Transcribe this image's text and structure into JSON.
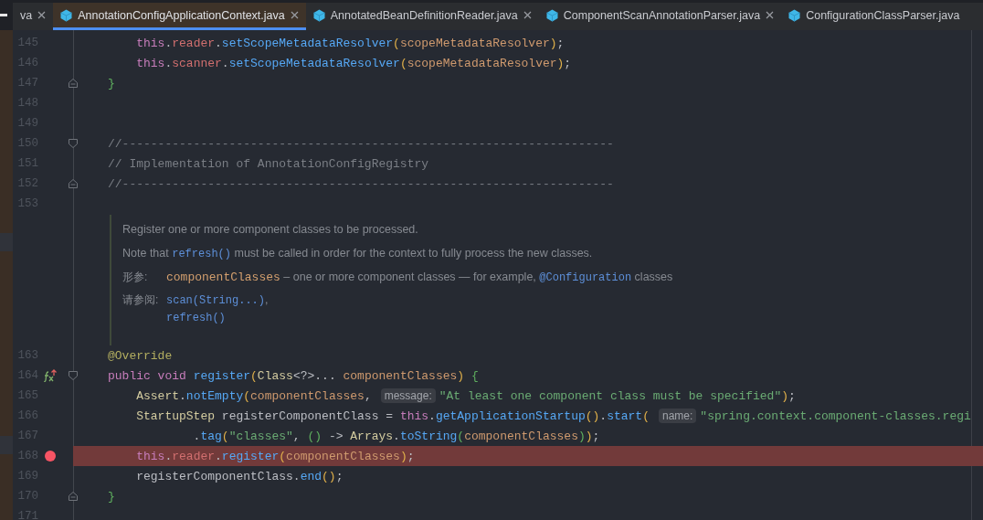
{
  "tabs": [
    {
      "label": "va",
      "selected": false,
      "closable": true,
      "icon": false
    },
    {
      "label": "AnnotationConfigApplicationContext.java",
      "selected": true,
      "closable": true,
      "icon": true
    },
    {
      "label": "AnnotatedBeanDefinitionReader.java",
      "selected": false,
      "closable": true,
      "icon": true
    },
    {
      "label": "ComponentScanAnnotationParser.java",
      "selected": false,
      "closable": true,
      "icon": true
    },
    {
      "label": "ConfigurationClassParser.java",
      "selected": false,
      "closable": false,
      "icon": true
    }
  ],
  "editor": {
    "lines_before": [
      {
        "number": "145",
        "fold_start": false,
        "fold_end": false,
        "breakpoint": false,
        "marker": false,
        "tokens": [
          {
            "kind": "kw",
            "text": "    this"
          },
          {
            "kind": "plain",
            "text": "."
          },
          {
            "kind": "field",
            "text": "reader"
          },
          {
            "kind": "plain",
            "text": "."
          },
          {
            "kind": "method",
            "text": "setScopeMetadataResolver"
          },
          {
            "kind": "paren",
            "text": "("
          },
          {
            "kind": "param",
            "text": "scopeMetadataResolver"
          },
          {
            "kind": "paren",
            "text": ")"
          },
          {
            "kind": "plain",
            "text": ";"
          }
        ]
      },
      {
        "number": "146",
        "fold_start": false,
        "fold_end": false,
        "breakpoint": false,
        "marker": false,
        "tokens": [
          {
            "kind": "kw",
            "text": "    this"
          },
          {
            "kind": "plain",
            "text": "."
          },
          {
            "kind": "field",
            "text": "scanner"
          },
          {
            "kind": "plain",
            "text": "."
          },
          {
            "kind": "method",
            "text": "setScopeMetadataResolver"
          },
          {
            "kind": "paren",
            "text": "("
          },
          {
            "kind": "param",
            "text": "scopeMetadataResolver"
          },
          {
            "kind": "paren",
            "text": ")"
          },
          {
            "kind": "plain",
            "text": ";"
          }
        ]
      },
      {
        "number": "147",
        "fold_start": false,
        "fold_end": true,
        "breakpoint": false,
        "marker": false,
        "tokens": [
          {
            "kind": "brace",
            "text": "}"
          }
        ]
      },
      {
        "number": "148",
        "fold_start": false,
        "fold_end": false,
        "breakpoint": false,
        "marker": false
      },
      {
        "number": "149",
        "fold_start": false,
        "fold_end": false,
        "breakpoint": false,
        "marker": false
      },
      {
        "number": "150",
        "fold_start": true,
        "fold_end": false,
        "breakpoint": false,
        "marker": false,
        "tokens": [
          {
            "kind": "comment",
            "text": "//---------------------------------------------------------------------"
          }
        ]
      },
      {
        "number": "151",
        "fold_start": false,
        "fold_end": false,
        "breakpoint": false,
        "marker": false,
        "tokens": [
          {
            "kind": "comment",
            "text": "// Implementation of AnnotationConfigRegistry"
          }
        ]
      },
      {
        "number": "152",
        "fold_start": false,
        "fold_end": true,
        "breakpoint": false,
        "marker": false,
        "tokens": [
          {
            "kind": "comment",
            "text": "//---------------------------------------------------------------------"
          }
        ]
      },
      {
        "number": "153",
        "fold_start": false,
        "fold_end": false,
        "breakpoint": false,
        "marker": false
      }
    ],
    "doc_comment": {
      "paragraphs": [
        [
          {
            "kind": "text",
            "text": "Register one or more component classes to be processed."
          }
        ],
        [
          {
            "kind": "text",
            "text": "Note that "
          },
          {
            "kind": "link",
            "text": "refresh()"
          },
          {
            "kind": "text",
            "text": " must be called in order for the context to fully process the new classes."
          }
        ]
      ],
      "params": {
        "label": "形参:",
        "segments": [
          {
            "kind": "name",
            "text": "componentClasses"
          },
          {
            "kind": "text",
            "text": " – one or more component classes — for example, "
          },
          {
            "kind": "link",
            "text": "@Configuration"
          },
          {
            "kind": "text",
            "text": " classes"
          }
        ]
      },
      "see_also": {
        "label": "请参阅:",
        "items": [
          [
            {
              "kind": "link",
              "text": "scan(String...)"
            },
            {
              "kind": "text",
              "text": ","
            }
          ],
          [
            {
              "kind": "link",
              "text": "refresh()"
            }
          ]
        ]
      }
    },
    "lines_after": [
      {
        "number": "163",
        "fold_start": false,
        "fold_end": false,
        "breakpoint": false,
        "marker": false,
        "tokens": [
          {
            "kind": "annotation",
            "text": "@Override"
          }
        ]
      },
      {
        "number": "164",
        "fold_start": true,
        "fold_end": false,
        "breakpoint": false,
        "marker": true,
        "tokens": [
          {
            "kind": "kw",
            "text": "public void "
          },
          {
            "kind": "method",
            "text": "register"
          },
          {
            "kind": "paren",
            "text": "("
          },
          {
            "kind": "cls",
            "text": "Class"
          },
          {
            "kind": "plain",
            "text": "<?>... "
          },
          {
            "kind": "param",
            "text": "componentClasses"
          },
          {
            "kind": "paren",
            "text": ")"
          },
          {
            "kind": "brace",
            "text": " {"
          }
        ]
      },
      {
        "number": "165",
        "fold_start": false,
        "fold_end": false,
        "breakpoint": false,
        "marker": false,
        "tokens": [
          {
            "kind": "cls",
            "text": "    Assert"
          },
          {
            "kind": "plain",
            "text": "."
          },
          {
            "kind": "method",
            "text": "notEmpty"
          },
          {
            "kind": "paren",
            "text": "("
          },
          {
            "kind": "param",
            "text": "componentClasses"
          },
          {
            "kind": "plain",
            "text": ","
          },
          {
            "kind": "hint",
            "text": "message:"
          },
          {
            "kind": "str",
            "text": "\"At least one component class must be specified\""
          },
          {
            "kind": "paren",
            "text": ")"
          },
          {
            "kind": "plain",
            "text": ";"
          }
        ]
      },
      {
        "number": "166",
        "fold_start": false,
        "fold_end": false,
        "breakpoint": false,
        "marker": false,
        "tokens": [
          {
            "kind": "cls",
            "text": "    StartupStep"
          },
          {
            "kind": "plain",
            "text": " registerComponentClass = "
          },
          {
            "kind": "kw",
            "text": "this"
          },
          {
            "kind": "plain",
            "text": "."
          },
          {
            "kind": "method",
            "text": "getApplicationStartup"
          },
          {
            "kind": "paren",
            "text": "()"
          },
          {
            "kind": "plain",
            "text": "."
          },
          {
            "kind": "method",
            "text": "start"
          },
          {
            "kind": "paren",
            "text": "("
          },
          {
            "kind": "hint",
            "text": "name:"
          },
          {
            "kind": "str",
            "text": "\"spring.context.component-classes.regi"
          }
        ]
      },
      {
        "number": "167",
        "fold_start": false,
        "fold_end": false,
        "breakpoint": false,
        "marker": false,
        "tokens": [
          {
            "kind": "plain",
            "text": "            ."
          },
          {
            "kind": "method",
            "text": "tag"
          },
          {
            "kind": "paren",
            "text": "("
          },
          {
            "kind": "str",
            "text": "\"classes\""
          },
          {
            "kind": "plain",
            "text": ", "
          },
          {
            "kind": "paren2",
            "text": "()"
          },
          {
            "kind": "plain",
            "text": " -> "
          },
          {
            "kind": "cls",
            "text": "Arrays"
          },
          {
            "kind": "plain",
            "text": "."
          },
          {
            "kind": "method",
            "text": "toString"
          },
          {
            "kind": "paren2",
            "text": "("
          },
          {
            "kind": "param",
            "text": "componentClasses"
          },
          {
            "kind": "paren2",
            "text": ")"
          },
          {
            "kind": "paren",
            "text": ")"
          },
          {
            "kind": "plain",
            "text": ";"
          }
        ]
      },
      {
        "number": "168",
        "fold_start": false,
        "fold_end": false,
        "breakpoint": true,
        "marker": false,
        "tokens": [
          {
            "kind": "kw",
            "text": "    this"
          },
          {
            "kind": "plain",
            "text": "."
          },
          {
            "kind": "field",
            "text": "reader"
          },
          {
            "kind": "plain",
            "text": "."
          },
          {
            "kind": "method",
            "text": "register"
          },
          {
            "kind": "paren",
            "text": "("
          },
          {
            "kind": "param",
            "text": "componentClasses"
          },
          {
            "kind": "paren",
            "text": ")"
          },
          {
            "kind": "plain",
            "text": ";"
          }
        ]
      },
      {
        "number": "169",
        "fold_start": false,
        "fold_end": false,
        "breakpoint": false,
        "marker": false,
        "tokens": [
          {
            "kind": "plain",
            "text": "    registerComponentClass."
          },
          {
            "kind": "method",
            "text": "end"
          },
          {
            "kind": "paren",
            "text": "()"
          },
          {
            "kind": "plain",
            "text": ";"
          }
        ]
      },
      {
        "number": "170",
        "fold_start": false,
        "fold_end": true,
        "breakpoint": false,
        "marker": false,
        "tokens": [
          {
            "kind": "brace",
            "text": "}"
          }
        ]
      },
      {
        "number": "171",
        "fold_start": false,
        "fold_end": false,
        "breakpoint": false,
        "marker": false
      }
    ]
  }
}
